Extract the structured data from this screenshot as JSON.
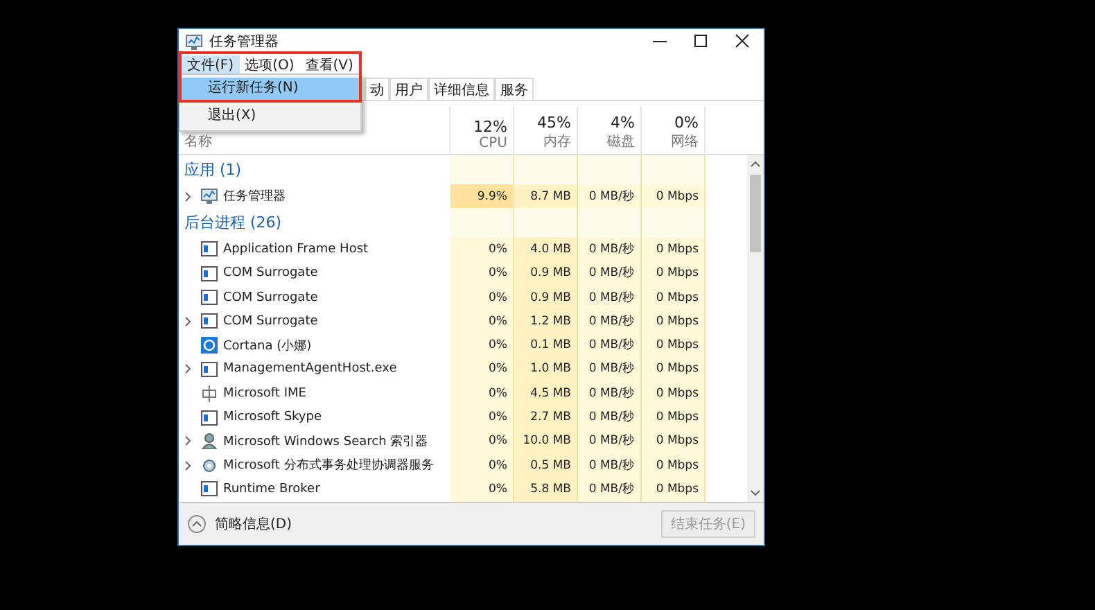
{
  "window": {
    "title": "任务管理器"
  },
  "menu": [
    {
      "label": "文件(F)",
      "selected": true
    },
    {
      "label": "选项(O)",
      "selected": false
    },
    {
      "label": "查看(V)",
      "selected": false
    }
  ],
  "dropdown": [
    {
      "label": "运行新任务(N)",
      "selected": true
    },
    {
      "label": "退出(X)",
      "selected": false
    }
  ],
  "tabs": [
    {
      "label": "动",
      "selected": false
    },
    {
      "label": "用户",
      "selected": false
    },
    {
      "label": "详细信息",
      "selected": false
    },
    {
      "label": "服务",
      "selected": false
    }
  ],
  "columns": [
    {
      "label": "名称"
    },
    {
      "usage": "12%",
      "label": "CPU"
    },
    {
      "usage": "45%",
      "label": "内存"
    },
    {
      "usage": "4%",
      "label": "磁盘"
    },
    {
      "usage": "0%",
      "label": "网络"
    }
  ],
  "groups": [
    {
      "title": "应用 (1)",
      "rows": [
        {
          "name": "任务管理器",
          "kind": "taskmgr",
          "expandable": true,
          "hot": true,
          "cpu": "9.9%",
          "memory": "8.7 MB",
          "disk": "0 MB/秒",
          "network": "0 Mbps"
        }
      ]
    },
    {
      "title": "后台进程 (26)",
      "rows": [
        {
          "name": "Application Frame Host",
          "kind": "window",
          "expandable": false,
          "hot": false,
          "cpu": "0%",
          "memory": "4.0 MB",
          "disk": "0 MB/秒",
          "network": "0 Mbps"
        },
        {
          "name": "COM Surrogate",
          "kind": "window",
          "expandable": false,
          "hot": false,
          "cpu": "0%",
          "memory": "0.9 MB",
          "disk": "0 MB/秒",
          "network": "0 Mbps"
        },
        {
          "name": "COM Surrogate",
          "kind": "window",
          "expandable": false,
          "hot": false,
          "cpu": "0%",
          "memory": "0.9 MB",
          "disk": "0 MB/秒",
          "network": "0 Mbps"
        },
        {
          "name": "COM Surrogate",
          "kind": "window",
          "expandable": true,
          "hot": false,
          "cpu": "0%",
          "memory": "1.2 MB",
          "disk": "0 MB/秒",
          "network": "0 Mbps"
        },
        {
          "name": "Cortana (小娜)",
          "kind": "ring",
          "expandable": false,
          "hot": false,
          "cpu": "0%",
          "memory": "0.1 MB",
          "disk": "0 MB/秒",
          "network": "0 Mbps"
        },
        {
          "name": "ManagementAgentHost.exe",
          "kind": "window",
          "expandable": true,
          "hot": false,
          "cpu": "0%",
          "memory": "1.0 MB",
          "disk": "0 MB/秒",
          "network": "0 Mbps"
        },
        {
          "name": "Microsoft IME",
          "kind": "ime",
          "expandable": false,
          "hot": false,
          "cpu": "0%",
          "memory": "4.5 MB",
          "disk": "0 MB/秒",
          "network": "0 Mbps"
        },
        {
          "name": "Microsoft Skype",
          "kind": "window",
          "expandable": false,
          "hot": false,
          "cpu": "0%",
          "memory": "2.7 MB",
          "disk": "0 MB/秒",
          "network": "0 Mbps"
        },
        {
          "name": "Microsoft Windows Search 索引器",
          "kind": "person",
          "expandable": true,
          "hot": false,
          "cpu": "0%",
          "memory": "10.0 MB",
          "disk": "0 MB/秒",
          "network": "0 Mbps"
        },
        {
          "name": "Microsoft 分布式事务处理协调器服务",
          "kind": "service",
          "expandable": true,
          "hot": false,
          "cpu": "0%",
          "memory": "0.5 MB",
          "disk": "0 MB/秒",
          "network": "0 Mbps"
        },
        {
          "name": "Runtime Broker",
          "kind": "window",
          "expandable": false,
          "hot": false,
          "cpu": "0%",
          "memory": "5.8 MB",
          "disk": "0 MB/秒",
          "network": "0 Mbps"
        }
      ]
    }
  ],
  "footer": {
    "toggle": "简略信息(D)",
    "end_button": {
      "label": "结束任务(E)",
      "disabled": true
    }
  }
}
